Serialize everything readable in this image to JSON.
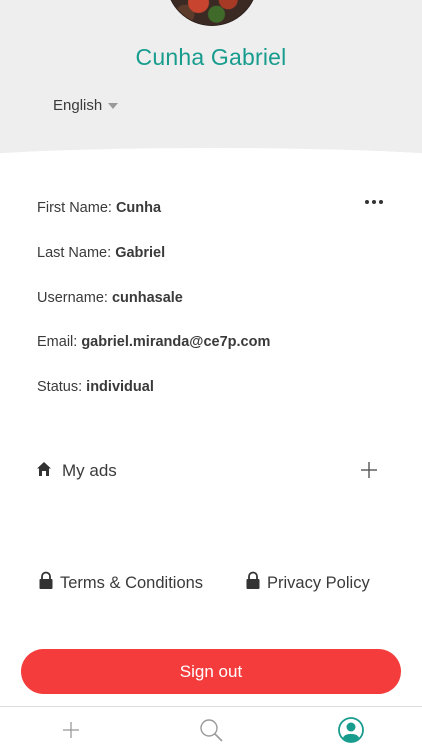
{
  "profile": {
    "display_name": "Cunha Gabriel",
    "language": "English"
  },
  "details": [
    {
      "label": "First Name:",
      "value": "Cunha"
    },
    {
      "label": "Last Name:",
      "value": "Gabriel"
    },
    {
      "label": "Username:",
      "value": "cunhasale"
    },
    {
      "label": "Email:",
      "value": "gabriel.miranda@ce7p.com"
    },
    {
      "label": "Status:",
      "value": "individual"
    }
  ],
  "my_ads": {
    "label": "My ads"
  },
  "links": {
    "terms": "Terms & Conditions",
    "privacy": "Privacy Policy"
  },
  "sign_out_label": "Sign out",
  "icons": {
    "more": "more-horizontal-icon",
    "home": "home-icon",
    "add": "plus-icon",
    "lock": "lock-icon",
    "tab_add": "plus-icon",
    "tab_search": "search-icon",
    "tab_profile": "user-icon"
  },
  "colors": {
    "accent": "#189c8e",
    "sign_out": "#f53c3c",
    "header_bg": "#eeeeee"
  }
}
